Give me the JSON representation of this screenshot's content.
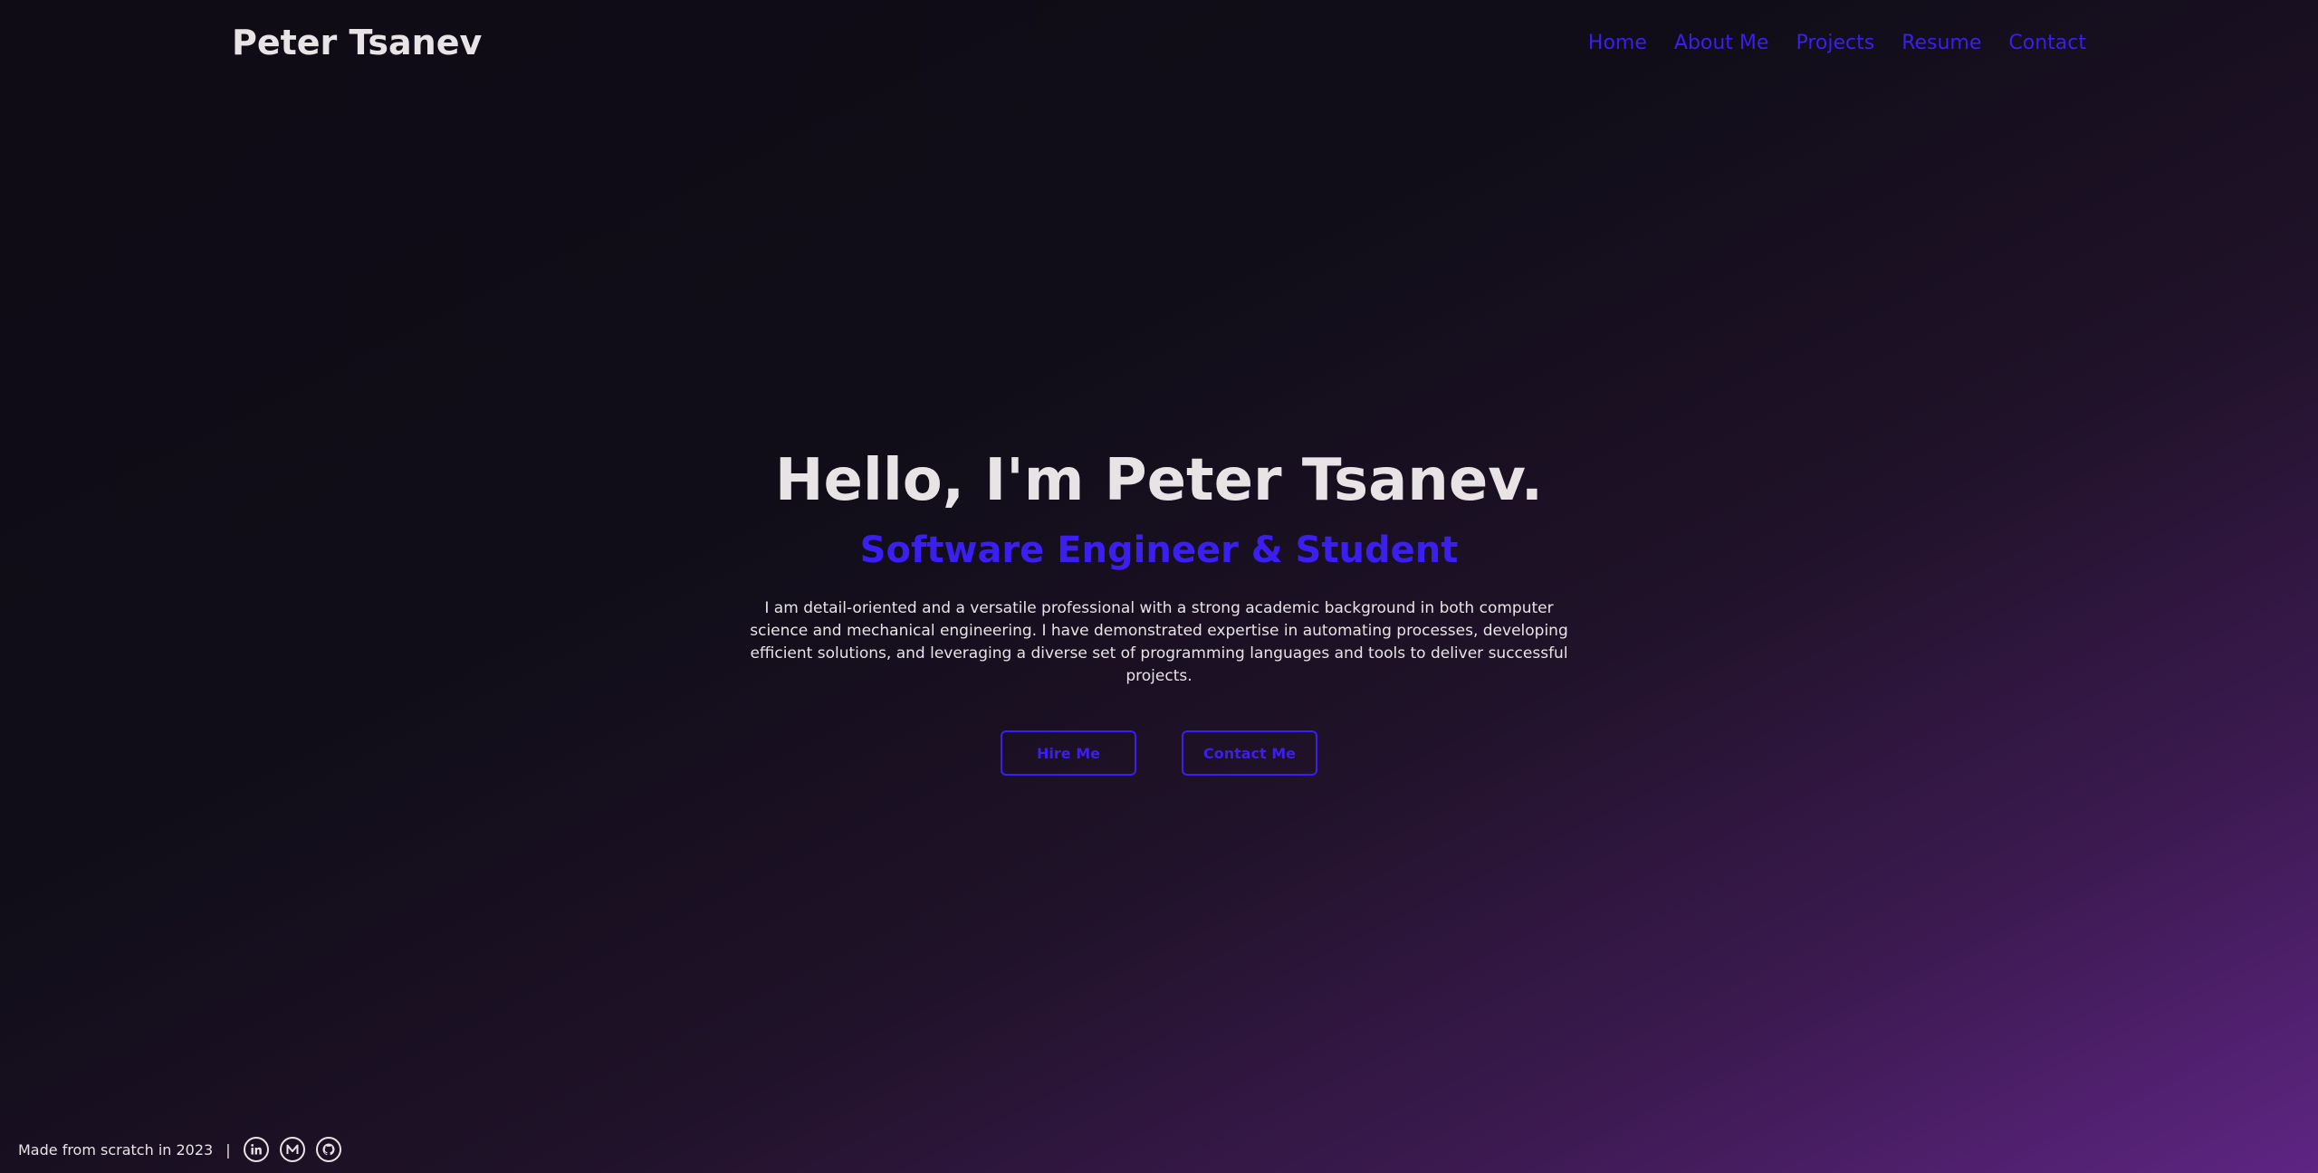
{
  "header": {
    "brand": "Peter Tsanev",
    "nav": [
      {
        "label": "Home"
      },
      {
        "label": "About Me"
      },
      {
        "label": "Projects"
      },
      {
        "label": "Resume"
      },
      {
        "label": "Contact"
      }
    ]
  },
  "hero": {
    "title": "Hello, I'm Peter Tsanev.",
    "subtitle": "Software Engineer & Student",
    "description": "I am detail-oriented and a versatile professional with a strong academic background in both computer science and mechanical engineering. I have demonstrated expertise in automating processes, developing efficient solutions, and leveraging a diverse set of programming languages and tools to deliver successful projects.",
    "buttons": {
      "hire": "Hire Me",
      "contact": "Contact Me"
    }
  },
  "footer": {
    "text": "Made from scratch in 2023",
    "separator": "|",
    "social": [
      {
        "icon": "linkedin-icon"
      },
      {
        "icon": "medium-icon"
      },
      {
        "icon": "github-icon"
      }
    ]
  },
  "colors": {
    "accent": "#3b1ef0",
    "text": "#e8e4e6",
    "background_dark": "#0f0c16",
    "background_glow": "#5e2583"
  }
}
